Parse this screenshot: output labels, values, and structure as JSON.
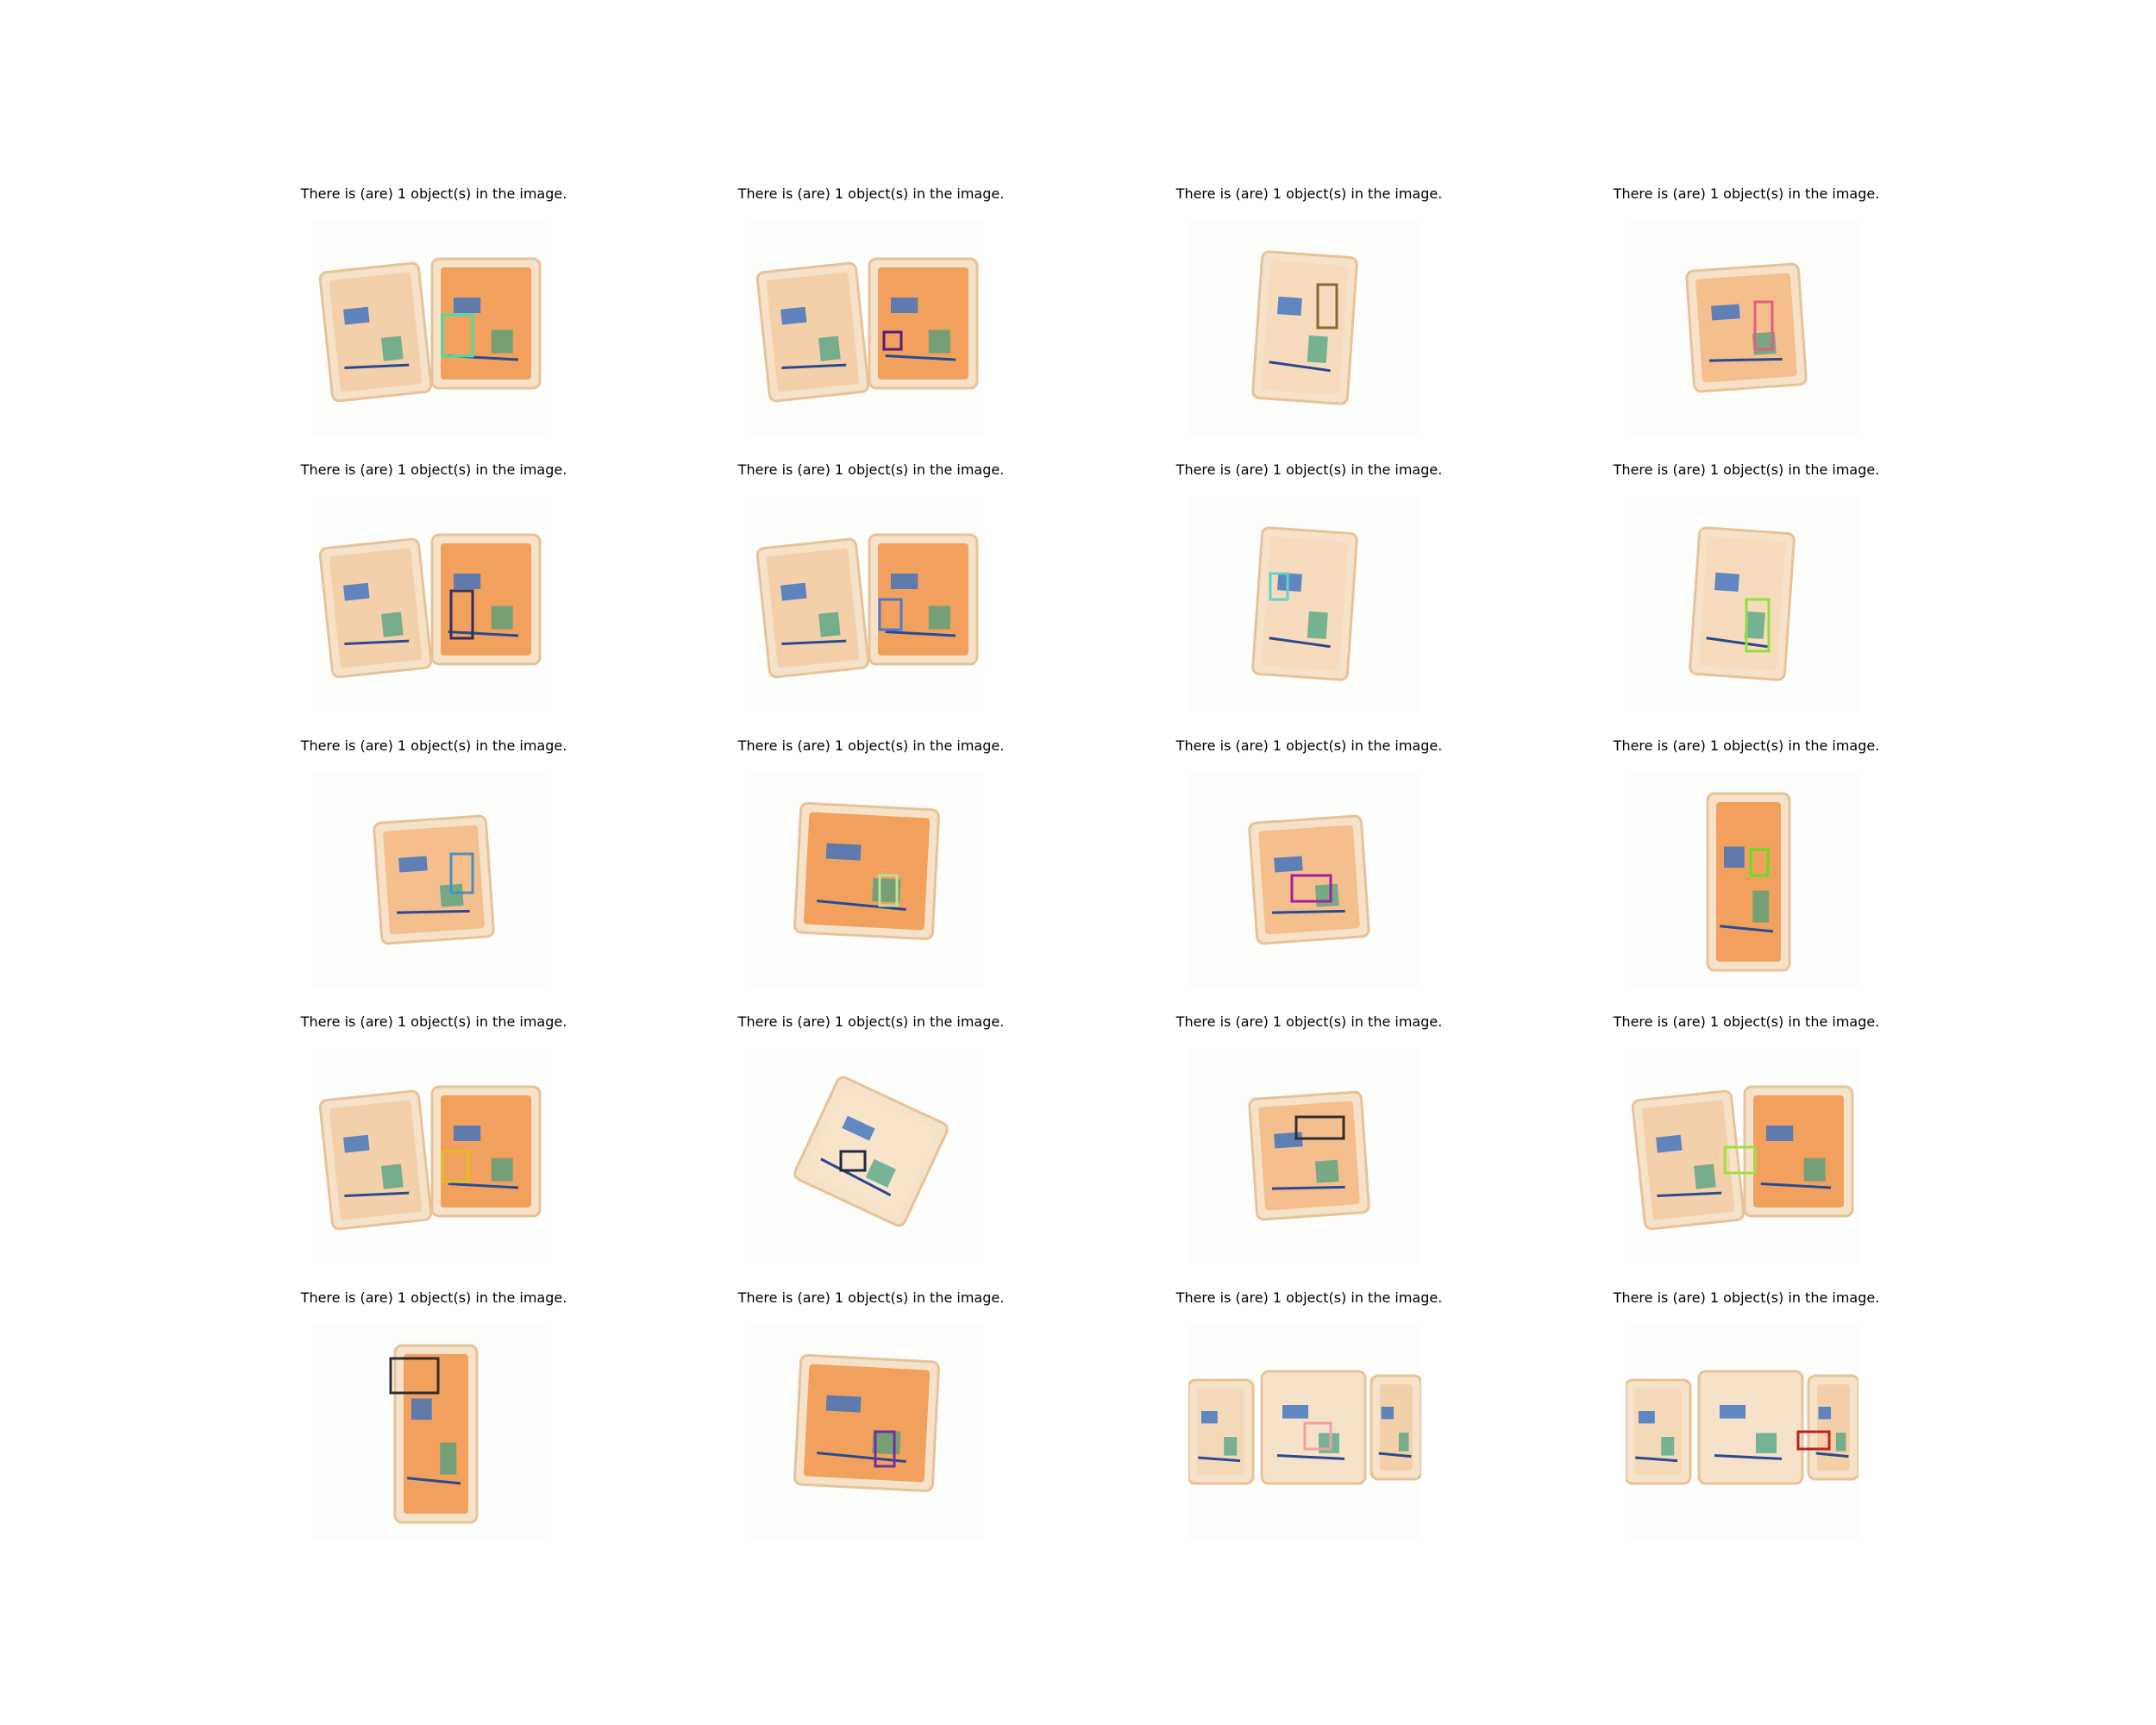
{
  "figure": {
    "panels": [
      {
        "caption": "There is (are) 1 object(s) in the image.",
        "box_color": "#3fe0a8",
        "scene": "two-bags"
      },
      {
        "caption": "There is (are) 1 object(s) in the image.",
        "box_color": "#5a1a7a",
        "scene": "two-bags"
      },
      {
        "caption": "There is (are) 1 object(s) in the image.",
        "box_color": "#8a6a30",
        "scene": "backpack"
      },
      {
        "caption": "There is (are) 1 object(s) in the image.",
        "box_color": "#e06080",
        "scene": "box"
      },
      {
        "caption": "There is (are) 1 object(s) in the image.",
        "box_color": "#303060",
        "scene": "two-bags"
      },
      {
        "caption": "There is (are) 1 object(s) in the image.",
        "box_color": "#4a7ad0",
        "scene": "two-bags"
      },
      {
        "caption": "There is (are) 1 object(s) in the image.",
        "box_color": "#60d0d0",
        "scene": "backpack"
      },
      {
        "caption": "There is (are) 1 object(s) in the image.",
        "box_color": "#90e040",
        "scene": "backpack"
      },
      {
        "caption": "There is (are) 1 object(s) in the image.",
        "box_color": "#4a90c0",
        "scene": "box"
      },
      {
        "caption": "There is (are) 1 object(s) in the image.",
        "box_color": "#c0e0a0",
        "scene": "suitcase"
      },
      {
        "caption": "There is (are) 1 object(s) in the image.",
        "box_color": "#a020a0",
        "scene": "box"
      },
      {
        "caption": "There is (are) 1 object(s) in the image.",
        "box_color": "#60e020",
        "scene": "tall-suitcase"
      },
      {
        "caption": "There is (are) 1 object(s) in the image.",
        "box_color": "#e0c020",
        "scene": "two-bags"
      },
      {
        "caption": "There is (are) 1 object(s) in the image.",
        "box_color": "#202840",
        "scene": "tilted-box"
      },
      {
        "caption": "There is (are) 1 object(s) in the image.",
        "box_color": "#303030",
        "scene": "box"
      },
      {
        "caption": "There is (are) 1 object(s) in the image.",
        "box_color": "#a0e040",
        "scene": "two-bags"
      },
      {
        "caption": "There is (are) 1 object(s) in the image.",
        "box_color": "#303030",
        "scene": "tall-suitcase"
      },
      {
        "caption": "There is (are) 1 object(s) in the image.",
        "box_color": "#7030a0",
        "scene": "suitcase"
      },
      {
        "caption": "There is (are) 1 object(s) in the image.",
        "box_color": "#f0a0a0",
        "scene": "three-bags"
      },
      {
        "caption": "There is (are) 1 object(s) in the image.",
        "box_color": "#c02020",
        "scene": "three-bags"
      }
    ]
  }
}
